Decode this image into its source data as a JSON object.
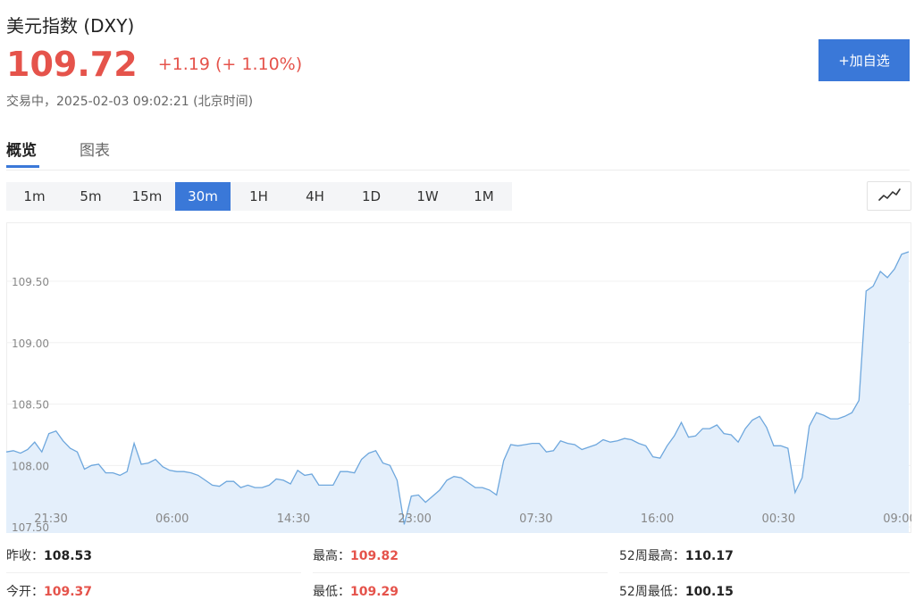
{
  "header": {
    "title": "美元指数 (DXY)",
    "price": "109.72",
    "change": "+1.19 (+ 1.10%)",
    "status": "交易中，2025-02-03 09:02:21 (北京时间)",
    "add_button": "+加自选"
  },
  "tabs": [
    {
      "label": "概览",
      "active": true
    },
    {
      "label": "图表",
      "active": false
    }
  ],
  "intervals": [
    {
      "label": "1m",
      "active": false
    },
    {
      "label": "5m",
      "active": false
    },
    {
      "label": "15m",
      "active": false
    },
    {
      "label": "30m",
      "active": true
    },
    {
      "label": "1H",
      "active": false
    },
    {
      "label": "4H",
      "active": false
    },
    {
      "label": "1D",
      "active": false
    },
    {
      "label": "1W",
      "active": false
    },
    {
      "label": "1M",
      "active": false
    }
  ],
  "chart_toggle_icon": "line-chart-icon",
  "colors": {
    "accent": "#3a78d8",
    "up": "#e5534b",
    "line": "#6ea7dd",
    "fill": "#e4effb"
  },
  "chart_data": {
    "type": "area",
    "ylim": [
      107.45,
      109.98
    ],
    "yticks": [
      "109.50",
      "109.00",
      "108.50",
      "108.00",
      "107.50"
    ],
    "ytick_values": [
      109.5,
      109.0,
      108.5,
      108.0,
      107.5
    ],
    "xticks": [
      "21:30",
      "06:00",
      "14:30",
      "23:00",
      "07:30",
      "16:00",
      "00:30",
      "09:00"
    ],
    "values": [
      108.11,
      108.12,
      108.1,
      108.13,
      108.19,
      108.11,
      108.26,
      108.28,
      108.2,
      108.14,
      108.11,
      107.97,
      108.0,
      108.01,
      107.94,
      107.94,
      107.92,
      107.95,
      108.18,
      108.01,
      108.02,
      108.05,
      107.99,
      107.96,
      107.95,
      107.95,
      107.94,
      107.92,
      107.88,
      107.84,
      107.83,
      107.87,
      107.87,
      107.82,
      107.84,
      107.82,
      107.82,
      107.84,
      107.89,
      107.88,
      107.85,
      107.96,
      107.92,
      107.93,
      107.84,
      107.84,
      107.84,
      107.95,
      107.95,
      107.94,
      108.05,
      108.1,
      108.12,
      108.02,
      108.0,
      107.88,
      107.52,
      107.75,
      107.76,
      107.7,
      107.75,
      107.8,
      107.88,
      107.91,
      107.9,
      107.86,
      107.82,
      107.82,
      107.8,
      107.76,
      108.04,
      108.17,
      108.16,
      108.17,
      108.18,
      108.18,
      108.11,
      108.12,
      108.2,
      108.18,
      108.17,
      108.13,
      108.15,
      108.17,
      108.21,
      108.19,
      108.2,
      108.22,
      108.21,
      108.18,
      108.16,
      108.07,
      108.06,
      108.16,
      108.24,
      108.35,
      108.23,
      108.24,
      108.3,
      108.3,
      108.33,
      108.26,
      108.25,
      108.19,
      108.3,
      108.37,
      108.4,
      108.31,
      108.16,
      108.16,
      108.14,
      107.78,
      107.9,
      108.32,
      108.43,
      108.41,
      108.38,
      108.38,
      108.4,
      108.43,
      108.53,
      109.42,
      109.46,
      109.58,
      109.53,
      109.6,
      109.72,
      109.74
    ]
  },
  "stats": {
    "prev_close_label": "昨收：",
    "prev_close": "108.53",
    "high_label": "最高：",
    "high": "109.82",
    "high52_label": "52周最高：",
    "high52": "110.17",
    "open_label": "今开：",
    "open": "109.37",
    "low_label": "最低：",
    "low": "109.29",
    "low52_label": "52周最低：",
    "low52": "100.15"
  }
}
